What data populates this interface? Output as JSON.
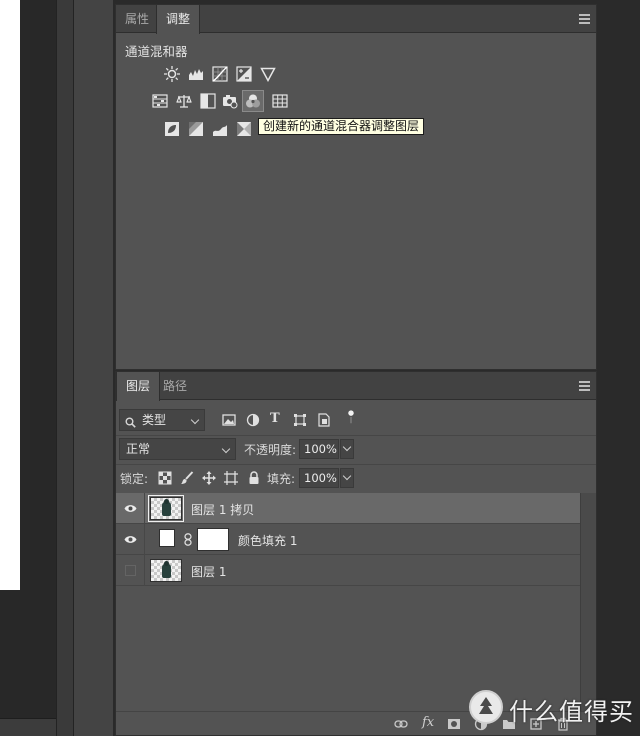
{
  "adjustments_panel": {
    "tabs": [
      {
        "label": "属性",
        "active": false
      },
      {
        "label": "调整",
        "active": true
      }
    ],
    "title": "通道混和器",
    "icons_row1": [
      "brightness-contrast-icon",
      "levels-icon",
      "curves-icon",
      "exposure-icon",
      "vibrance-triangle-icon"
    ],
    "icons_row2": [
      "hue-saturation-icon",
      "color-balance-icon",
      "black-white-icon",
      "photo-filter-icon",
      "channel-mixer-icon",
      "color-lookup-icon"
    ],
    "icons_row3": [
      "invert-icon",
      "posterize-icon",
      "threshold-icon",
      "gradient-map-icon"
    ],
    "tooltip": "创建新的通道混合器调整图层"
  },
  "layers_panel": {
    "tabs": [
      {
        "label": "图层",
        "active": true
      },
      {
        "label": "路径",
        "active": false
      }
    ],
    "filter": {
      "label": "类型"
    },
    "blend_mode": "正常",
    "opacity_label": "不透明度:",
    "opacity_value": "100%",
    "lock_label": "锁定:",
    "fill_label": "填充:",
    "fill_value": "100%",
    "layers": [
      {
        "name": "图层 1 拷贝",
        "visible": true,
        "selected": true,
        "kind": "pixel"
      },
      {
        "name": "颜色填充 1",
        "visible": true,
        "selected": false,
        "kind": "fill"
      },
      {
        "name": "图层 1",
        "visible": false,
        "selected": false,
        "kind": "pixel"
      }
    ],
    "fx_label": "fx"
  },
  "watermark": {
    "text": "什么值得买"
  },
  "colors": {
    "panel_bg": "#535353",
    "selected_row": "#696969",
    "tooltip_bg": "#ffffe1"
  }
}
